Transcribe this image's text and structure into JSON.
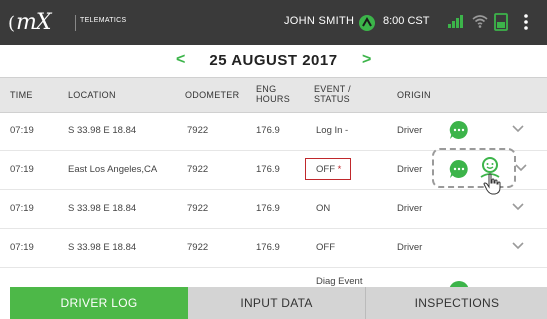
{
  "header": {
    "logo": "mX",
    "logo_back": "(",
    "tag": "TELEMATICS",
    "driver": "JOHN SMITH",
    "time": "8:00 CST",
    "colors": {
      "bar": "#3a3a3a",
      "accent": "#3cb44a"
    }
  },
  "datebar": {
    "prev": "<",
    "date": "25 AUGUST 2017",
    "next": ">"
  },
  "columns": {
    "time": "TIME",
    "location": "LOCATION",
    "odometer": "ODOMETER",
    "eng_hours": "ENG HOURS",
    "event_status": "EVENT / STATUS",
    "origin": "ORIGIN"
  },
  "rows": [
    {
      "time": "07:19",
      "location": "S 33.98 E 18.84",
      "odometer": "7922",
      "eng_hours": "176.9",
      "event": "Log In -",
      "origin": "Driver"
    },
    {
      "time": "07:19",
      "location": "East Los Angeles,CA",
      "odometer": "7922",
      "eng_hours": "176.9",
      "event": "OFF",
      "event_marker": "*",
      "origin": "Driver"
    },
    {
      "time": "07:19",
      "location": "S 33.98 E 18.84",
      "odometer": "7922",
      "eng_hours": "176.9",
      "event": "ON",
      "origin": "Driver"
    },
    {
      "time": "07:19",
      "location": "S 33.98 E 18.84",
      "odometer": "7922",
      "eng_hours": "176.9",
      "event": "OFF",
      "origin": "Driver"
    },
    {
      "event": "Diag Event"
    }
  ],
  "tabs": {
    "driver_log": "DRIVER LOG",
    "input_data": "INPUT DATA",
    "inspections": "INSPECTIONS"
  }
}
